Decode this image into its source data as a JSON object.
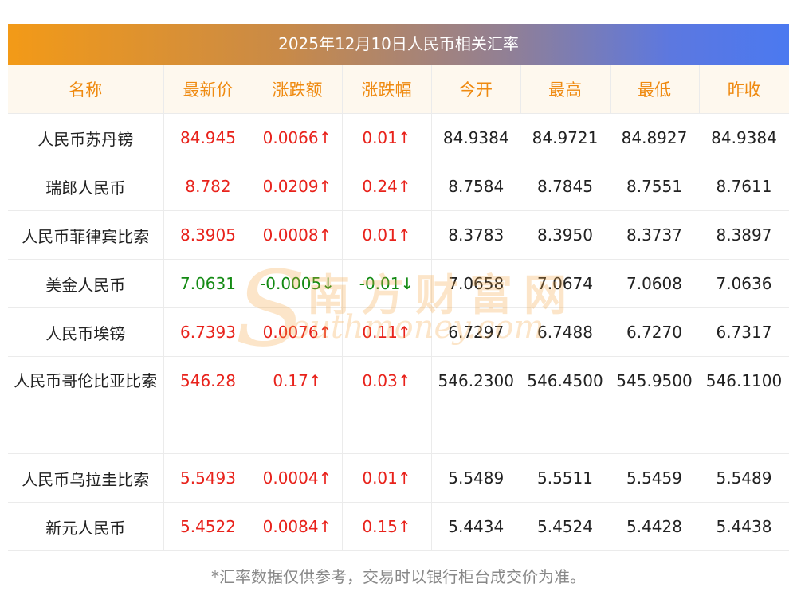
{
  "title": "2025年12月10日人民币相关汇率",
  "headers": [
    "名称",
    "最新价",
    "涨跌额",
    "涨跌幅",
    "今开",
    "最高",
    "最低",
    "昨收"
  ],
  "rows": [
    {
      "name": "人民币苏丹镑",
      "latest": "84.945",
      "change": "0.0066↑",
      "pct": "0.01↑",
      "open": "84.9384",
      "high": "84.9721",
      "low": "84.8927",
      "prev": "84.9384",
      "dir": "up"
    },
    {
      "name": "瑞郎人民币",
      "latest": "8.782",
      "change": "0.0209↑",
      "pct": "0.24↑",
      "open": "8.7584",
      "high": "8.7845",
      "low": "8.7551",
      "prev": "8.7611",
      "dir": "up"
    },
    {
      "name": "人民币菲律宾比索",
      "latest": "8.3905",
      "change": "0.0008↑",
      "pct": "0.01↑",
      "open": "8.3783",
      "high": "8.3950",
      "low": "8.3737",
      "prev": "8.3897",
      "dir": "up"
    },
    {
      "name": "美金人民币",
      "latest": "7.0631",
      "change": "-0.0005↓",
      "pct": "-0.01↓",
      "open": "7.0658",
      "high": "7.0674",
      "low": "7.0608",
      "prev": "7.0636",
      "dir": "down"
    },
    {
      "name": "人民币埃镑",
      "latest": "6.7393",
      "change": "0.0076↑",
      "pct": "0.11↑",
      "open": "6.7297",
      "high": "6.7488",
      "low": "6.7270",
      "prev": "6.7317",
      "dir": "up"
    },
    {
      "name": "人民币哥伦比亚比索",
      "latest": "546.28",
      "change": "0.17↑",
      "pct": "0.03↑",
      "open": "546.2300",
      "high": "546.4500",
      "low": "545.9500",
      "prev": "546.1100",
      "dir": "up"
    },
    {
      "name": "人民币乌拉圭比索",
      "latest": "5.5493",
      "change": "0.0004↑",
      "pct": "0.01↑",
      "open": "5.5489",
      "high": "5.5511",
      "low": "5.5459",
      "prev": "5.5489",
      "dir": "up"
    },
    {
      "name": "新元人民币",
      "latest": "5.4522",
      "change": "0.0084↑",
      "pct": "0.15↑",
      "open": "5.4434",
      "high": "5.4524",
      "low": "5.4428",
      "prev": "5.4438",
      "dir": "up"
    }
  ],
  "watermark": {
    "cn": "南方财富网",
    "en": "outhmoney.com",
    "initial": "S"
  },
  "footer": "*汇率数据仅供参考，交易时以银行柜台成交价为准。",
  "colors": {
    "up": "#e8221b",
    "down": "#138a13",
    "header_text": "#ef8a10",
    "header_bg": "#fef8ee"
  }
}
